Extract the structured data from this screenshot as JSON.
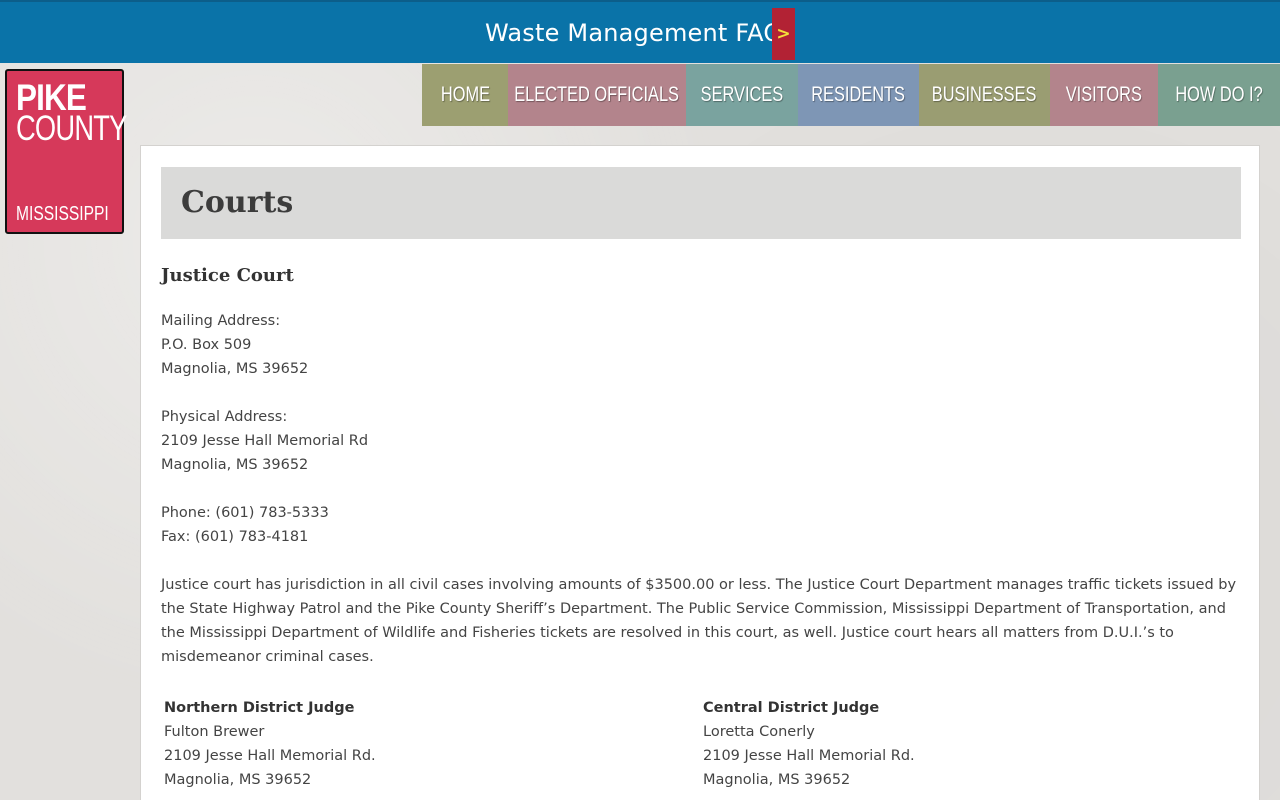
{
  "topbar": {
    "faq_label": "Waste Management FAQ",
    "arrow": ">"
  },
  "logo": {
    "line1": "PIKE",
    "line2": "COUNTY",
    "line3": "MISSISSIPPI"
  },
  "nav": [
    {
      "label": "HOME",
      "color": "#9c9f71"
    },
    {
      "label": "ELECTED OFFICIALS",
      "color": "#b3848c"
    },
    {
      "label": "SERVICES",
      "color": "#7aa39f"
    },
    {
      "label": "RESIDENTS",
      "color": "#7e96b5"
    },
    {
      "label": "BUSINESSES",
      "color": "#9a9d72"
    },
    {
      "label": "VISITORS",
      "color": "#b3848c"
    },
    {
      "label": "HOW DO I?",
      "color": "#7aa090"
    }
  ],
  "page_title": "Courts",
  "section_title": "Justice Court",
  "mailing": {
    "label": "Mailing Address:",
    "line1": "P.O. Box 509",
    "line2": "Magnolia, MS 39652"
  },
  "physical": {
    "label": "Physical Address:",
    "line1": "2109 Jesse Hall Memorial Rd",
    "line2": "Magnolia, MS 39652"
  },
  "contact": {
    "phone": "Phone: (601) 783-5333",
    "fax": "Fax: (601) 783-4181"
  },
  "description": "Justice court has jurisdiction in all civil cases involving amounts of $3500.00 or less. The Justice Court Department manages traffic tickets issued by the State Highway Patrol and the Pike County Sheriff’s Department. The Public Service Commission, Mississippi Department of Transportation, and the Mississippi Department of Wildlife and Fisheries tickets are resolved in this court, as well. Justice court hears all matters from D.U.I.’s to misdemeanor criminal cases.",
  "judges": [
    {
      "title": "Northern District Judge",
      "name": "Fulton Brewer",
      "address": "2109 Jesse Hall Memorial Rd.",
      "city": "Magnolia, MS 39652"
    },
    {
      "title": "Central District Judge",
      "name": "Loretta Conerly",
      "address": "2109 Jesse Hall Memorial Rd.",
      "city": "Magnolia, MS 39652"
    }
  ]
}
